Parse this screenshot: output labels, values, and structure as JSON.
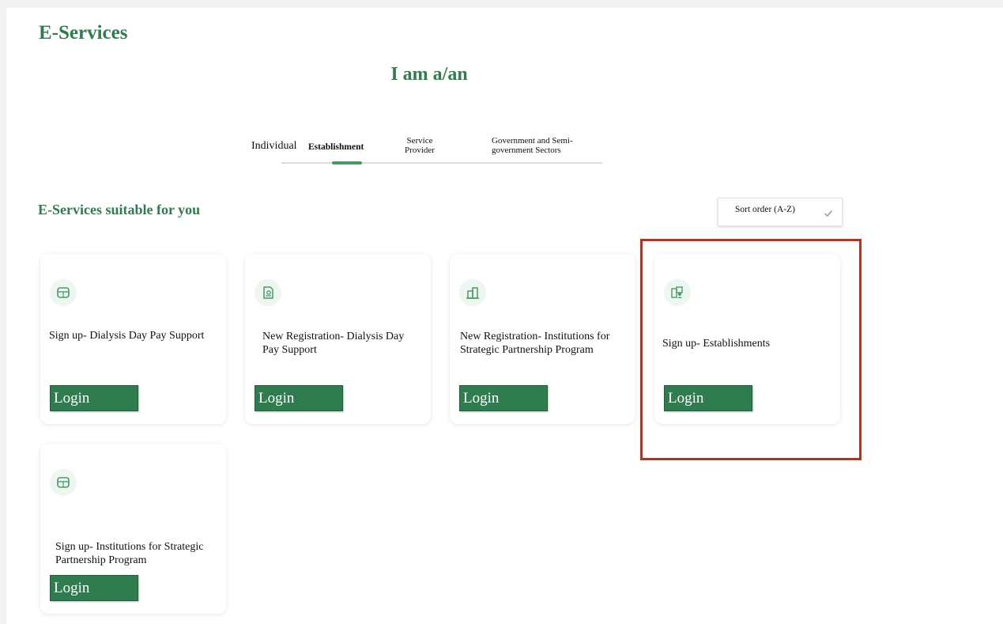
{
  "header": {
    "title": "E-Services",
    "role_heading": "I am a/an"
  },
  "tabs": [
    {
      "label": "Individual",
      "active": false
    },
    {
      "label": "Establishment",
      "active": true
    },
    {
      "label": "Service Provider",
      "active": false
    },
    {
      "label": "Government and Semi-government Sectors",
      "active": false
    }
  ],
  "section": {
    "title": "E-Services suitable for you"
  },
  "sort": {
    "label": "Sort order (A-Z)"
  },
  "cards": [
    {
      "title": "Sign up- Dialysis Day Pay Support",
      "button": "Login",
      "icon": "calendar-icon"
    },
    {
      "title": "New Registration- Dialysis Day Pay Support",
      "button": "Login",
      "icon": "document-icon"
    },
    {
      "title": "New Registration- Institutions for Strategic Partnership Program",
      "button": "Login",
      "icon": "building-icon"
    },
    {
      "title": "Sign up- Establishments",
      "button": "Login",
      "icon": "establishment-user-icon"
    },
    {
      "title": "Sign up- Institutions for Strategic Partnership Program",
      "button": "Login",
      "icon": "calendar-icon"
    }
  ],
  "colors": {
    "brand_green": "#2f7d4f",
    "highlight_red": "#b5341e"
  }
}
